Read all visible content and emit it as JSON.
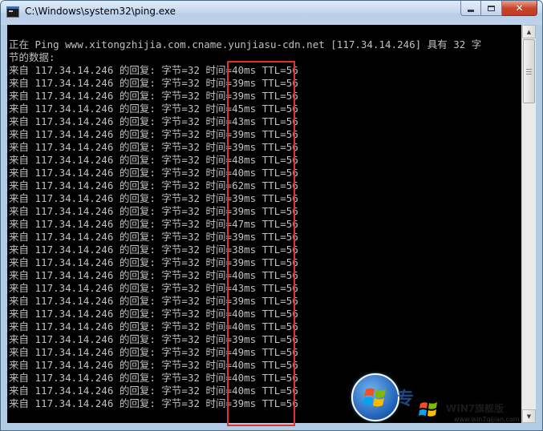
{
  "window": {
    "title": "C:\\Windows\\system32\\ping.exe",
    "title_icon": "console-icon",
    "controls": {
      "minimize_icon": "minimize-icon",
      "maximize_icon": "maximize-icon",
      "close_icon": "close-icon",
      "close_glyph": "✕"
    }
  },
  "console": {
    "lines": [
      "正在 Ping www.xitongzhijia.com.cname.yunjiasu-cdn.net [117.34.14.246] 具有 32 字",
      "节的数据:",
      "来自 117.34.14.246 的回复: 字节=32 时间=40ms TTL=56",
      "来自 117.34.14.246 的回复: 字节=32 时间=39ms TTL=56",
      "来自 117.34.14.246 的回复: 字节=32 时间=39ms TTL=56",
      "来自 117.34.14.246 的回复: 字节=32 时间=45ms TTL=56",
      "来自 117.34.14.246 的回复: 字节=32 时间=43ms TTL=56",
      "来自 117.34.14.246 的回复: 字节=32 时间=39ms TTL=56",
      "来自 117.34.14.246 的回复: 字节=32 时间=39ms TTL=56",
      "来自 117.34.14.246 的回复: 字节=32 时间=48ms TTL=56",
      "来自 117.34.14.246 的回复: 字节=32 时间=40ms TTL=56",
      "来自 117.34.14.246 的回复: 字节=32 时间=62ms TTL=56",
      "来自 117.34.14.246 的回复: 字节=32 时间=39ms TTL=56",
      "来自 117.34.14.246 的回复: 字节=32 时间=39ms TTL=56",
      "来自 117.34.14.246 的回复: 字节=32 时间=47ms TTL=56",
      "来自 117.34.14.246 的回复: 字节=32 时间=39ms TTL=56",
      "来自 117.34.14.246 的回复: 字节=32 时间=38ms TTL=56",
      "来自 117.34.14.246 的回复: 字节=32 时间=39ms TTL=56",
      "来自 117.34.14.246 的回复: 字节=32 时间=40ms TTL=56",
      "来自 117.34.14.246 的回复: 字节=32 时间=43ms TTL=56",
      "来自 117.34.14.246 的回复: 字节=32 时间=39ms TTL=56",
      "来自 117.34.14.246 的回复: 字节=32 时间=40ms TTL=56",
      "来自 117.34.14.246 的回复: 字节=32 时间=40ms TTL=56",
      "来自 117.34.14.246 的回复: 字节=32 时间=39ms TTL=56",
      "来自 117.34.14.246 的回复: 字节=32 时间=49ms TTL=56",
      "来自 117.34.14.246 的回复: 字节=32 时间=40ms TTL=56",
      "来自 117.34.14.246 的回复: 字节=32 时间=40ms TTL=56",
      "来自 117.34.14.246 的回复: 字节=32 时间=40ms TTL=56",
      "来自 117.34.14.246 的回复: 字节=32 时间=39ms TTL=56"
    ],
    "text_color": "#c0c0c0",
    "background_color": "#000000",
    "highlight_color": "#e03030"
  },
  "scrollbar": {
    "up_arrow": "▲",
    "down_arrow": "▼"
  },
  "watermark": {
    "logo_icon": "windows-logo-icon",
    "flag_icon": "windows-flag-icon",
    "cn_text": "专",
    "name": "WIN7旗舰版",
    "url": "www.win7qijian.com"
  }
}
